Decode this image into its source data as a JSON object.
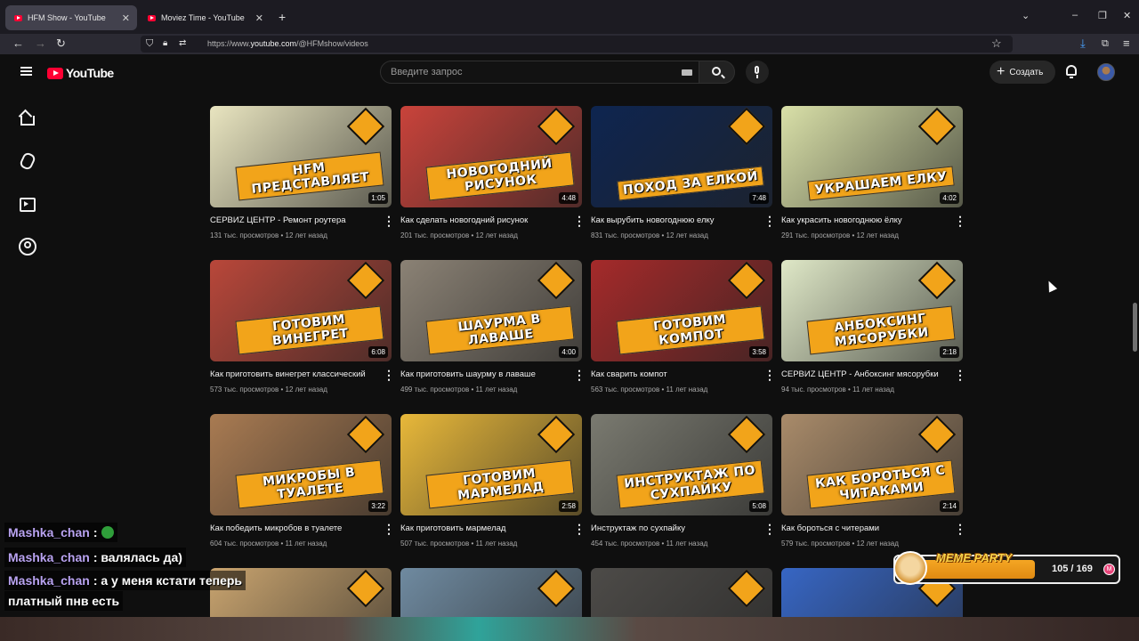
{
  "browser": {
    "tabs": [
      {
        "label": "HFM Show - YouTube",
        "active": true
      },
      {
        "label": "Moviez Time - YouTube",
        "active": false
      }
    ],
    "url_prefix": "https://www.",
    "url_domain": "youtube.com",
    "url_path": "/@HFMshow/videos"
  },
  "header": {
    "logo": "YouTube",
    "search_placeholder": "Введите запрос",
    "create_label": "Создать"
  },
  "videos": [
    {
      "title": "СЕРВИZ ЦЕНТР - Ремонт роутера",
      "meta": "131 тыс. просмотров • 12 лет назад",
      "duration": "1:05",
      "caption": "HFM ПРЕДСТАВЛЯЕТ",
      "bg": "#e9e5c0"
    },
    {
      "title": "Как сделать новогодний рисунок",
      "meta": "201 тыс. просмотров • 12 лет назад",
      "duration": "4:48",
      "caption": "НОВОГОДНИЙ РИСУНОК",
      "bg": "#c9433b"
    },
    {
      "title": "Как вырубить новогоднюю елку",
      "meta": "831 тыс. просмотров • 12 лет назад",
      "duration": "7:48",
      "caption": "ПОХОД ЗА ЕЛКОЙ",
      "bg": "#0e2550"
    },
    {
      "title": "Как украсить новогоднюю ёлку",
      "meta": "291 тыс. просмотров • 12 лет назад",
      "duration": "4:02",
      "caption": "УКРАШАЕМ ЕЛКУ",
      "bg": "#d9e0a8"
    },
    {
      "title": "Как приготовить винегрет классический",
      "meta": "573 тыс. просмотров • 12 лет назад",
      "duration": "6:08",
      "caption": "ГОТОВИМ ВИНЕГРЕТ",
      "bg": "#b9473a"
    },
    {
      "title": "Как приготовить шаурму в лаваше",
      "meta": "499 тыс. просмотров • 11 лет назад",
      "duration": "4:00",
      "caption": "ШАУРМА В ЛАВАШЕ",
      "bg": "#8b8275"
    },
    {
      "title": "Как сварить компот",
      "meta": "563 тыс. просмотров • 11 лет назад",
      "duration": "3:58",
      "caption": "ГОТОВИМ КОМПОТ",
      "bg": "#a52a2a"
    },
    {
      "title": "СЕРВИZ ЦЕНТР - Анбоксинг мясорубки",
      "meta": "94 тыс. просмотров • 11 лет назад",
      "duration": "2:18",
      "caption": "АНБОКСИНГ МЯСОРУБКИ",
      "bg": "#dfe8c7"
    },
    {
      "title": "Как победить микробов в туалете",
      "meta": "604 тыс. просмотров • 11 лет назад",
      "duration": "3:22",
      "caption": "МИКРОБЫ В ТУАЛЕТЕ",
      "bg": "#a97b52"
    },
    {
      "title": "Как приготовить мармелад",
      "meta": "507 тыс. просмотров • 11 лет назад",
      "duration": "2:58",
      "caption": "ГОТОВИМ МАРМЕЛАД",
      "bg": "#e8b83a"
    },
    {
      "title": "Инструктаж по сухпайку",
      "meta": "454 тыс. просмотров • 11 лет назад",
      "duration": "5:08",
      "caption": "ИНСТРУКТАЖ ПО СУХПАЙКУ",
      "bg": "#7a7a70"
    },
    {
      "title": "Как бороться с читерами",
      "meta": "579 тыс. просмотров • 12 лет назад",
      "duration": "2:14",
      "caption": "КАК БОРОТЬСЯ С ЧИТАКАМИ",
      "bg": "#a98b6a"
    },
    {
      "title": "",
      "meta": "",
      "duration": "",
      "caption": "",
      "bg": "#c9a46f"
    },
    {
      "title": "",
      "meta": "",
      "duration": "",
      "caption": "",
      "bg": "#6f8aa0"
    },
    {
      "title": "",
      "meta": "",
      "duration": "",
      "caption": "",
      "bg": "#4d4b48"
    },
    {
      "title": "",
      "meta": "",
      "duration": "",
      "caption": "",
      "bg": "#3766c4"
    }
  ],
  "chat": [
    {
      "user": "Mashka_chan",
      "text": ":",
      "emote": true
    },
    {
      "user": "Mashka_chan",
      "text": ": валялась да)",
      "emote": false
    },
    {
      "user": "Mashka_chan",
      "text": ": а у меня кстати теперь",
      "emote": false
    },
    {
      "user": "",
      "text": "платный пнв есть",
      "emote": false
    }
  ],
  "meme_party": {
    "label": "MEME PARTY",
    "count": "105 / 169",
    "progress": 0.62
  }
}
